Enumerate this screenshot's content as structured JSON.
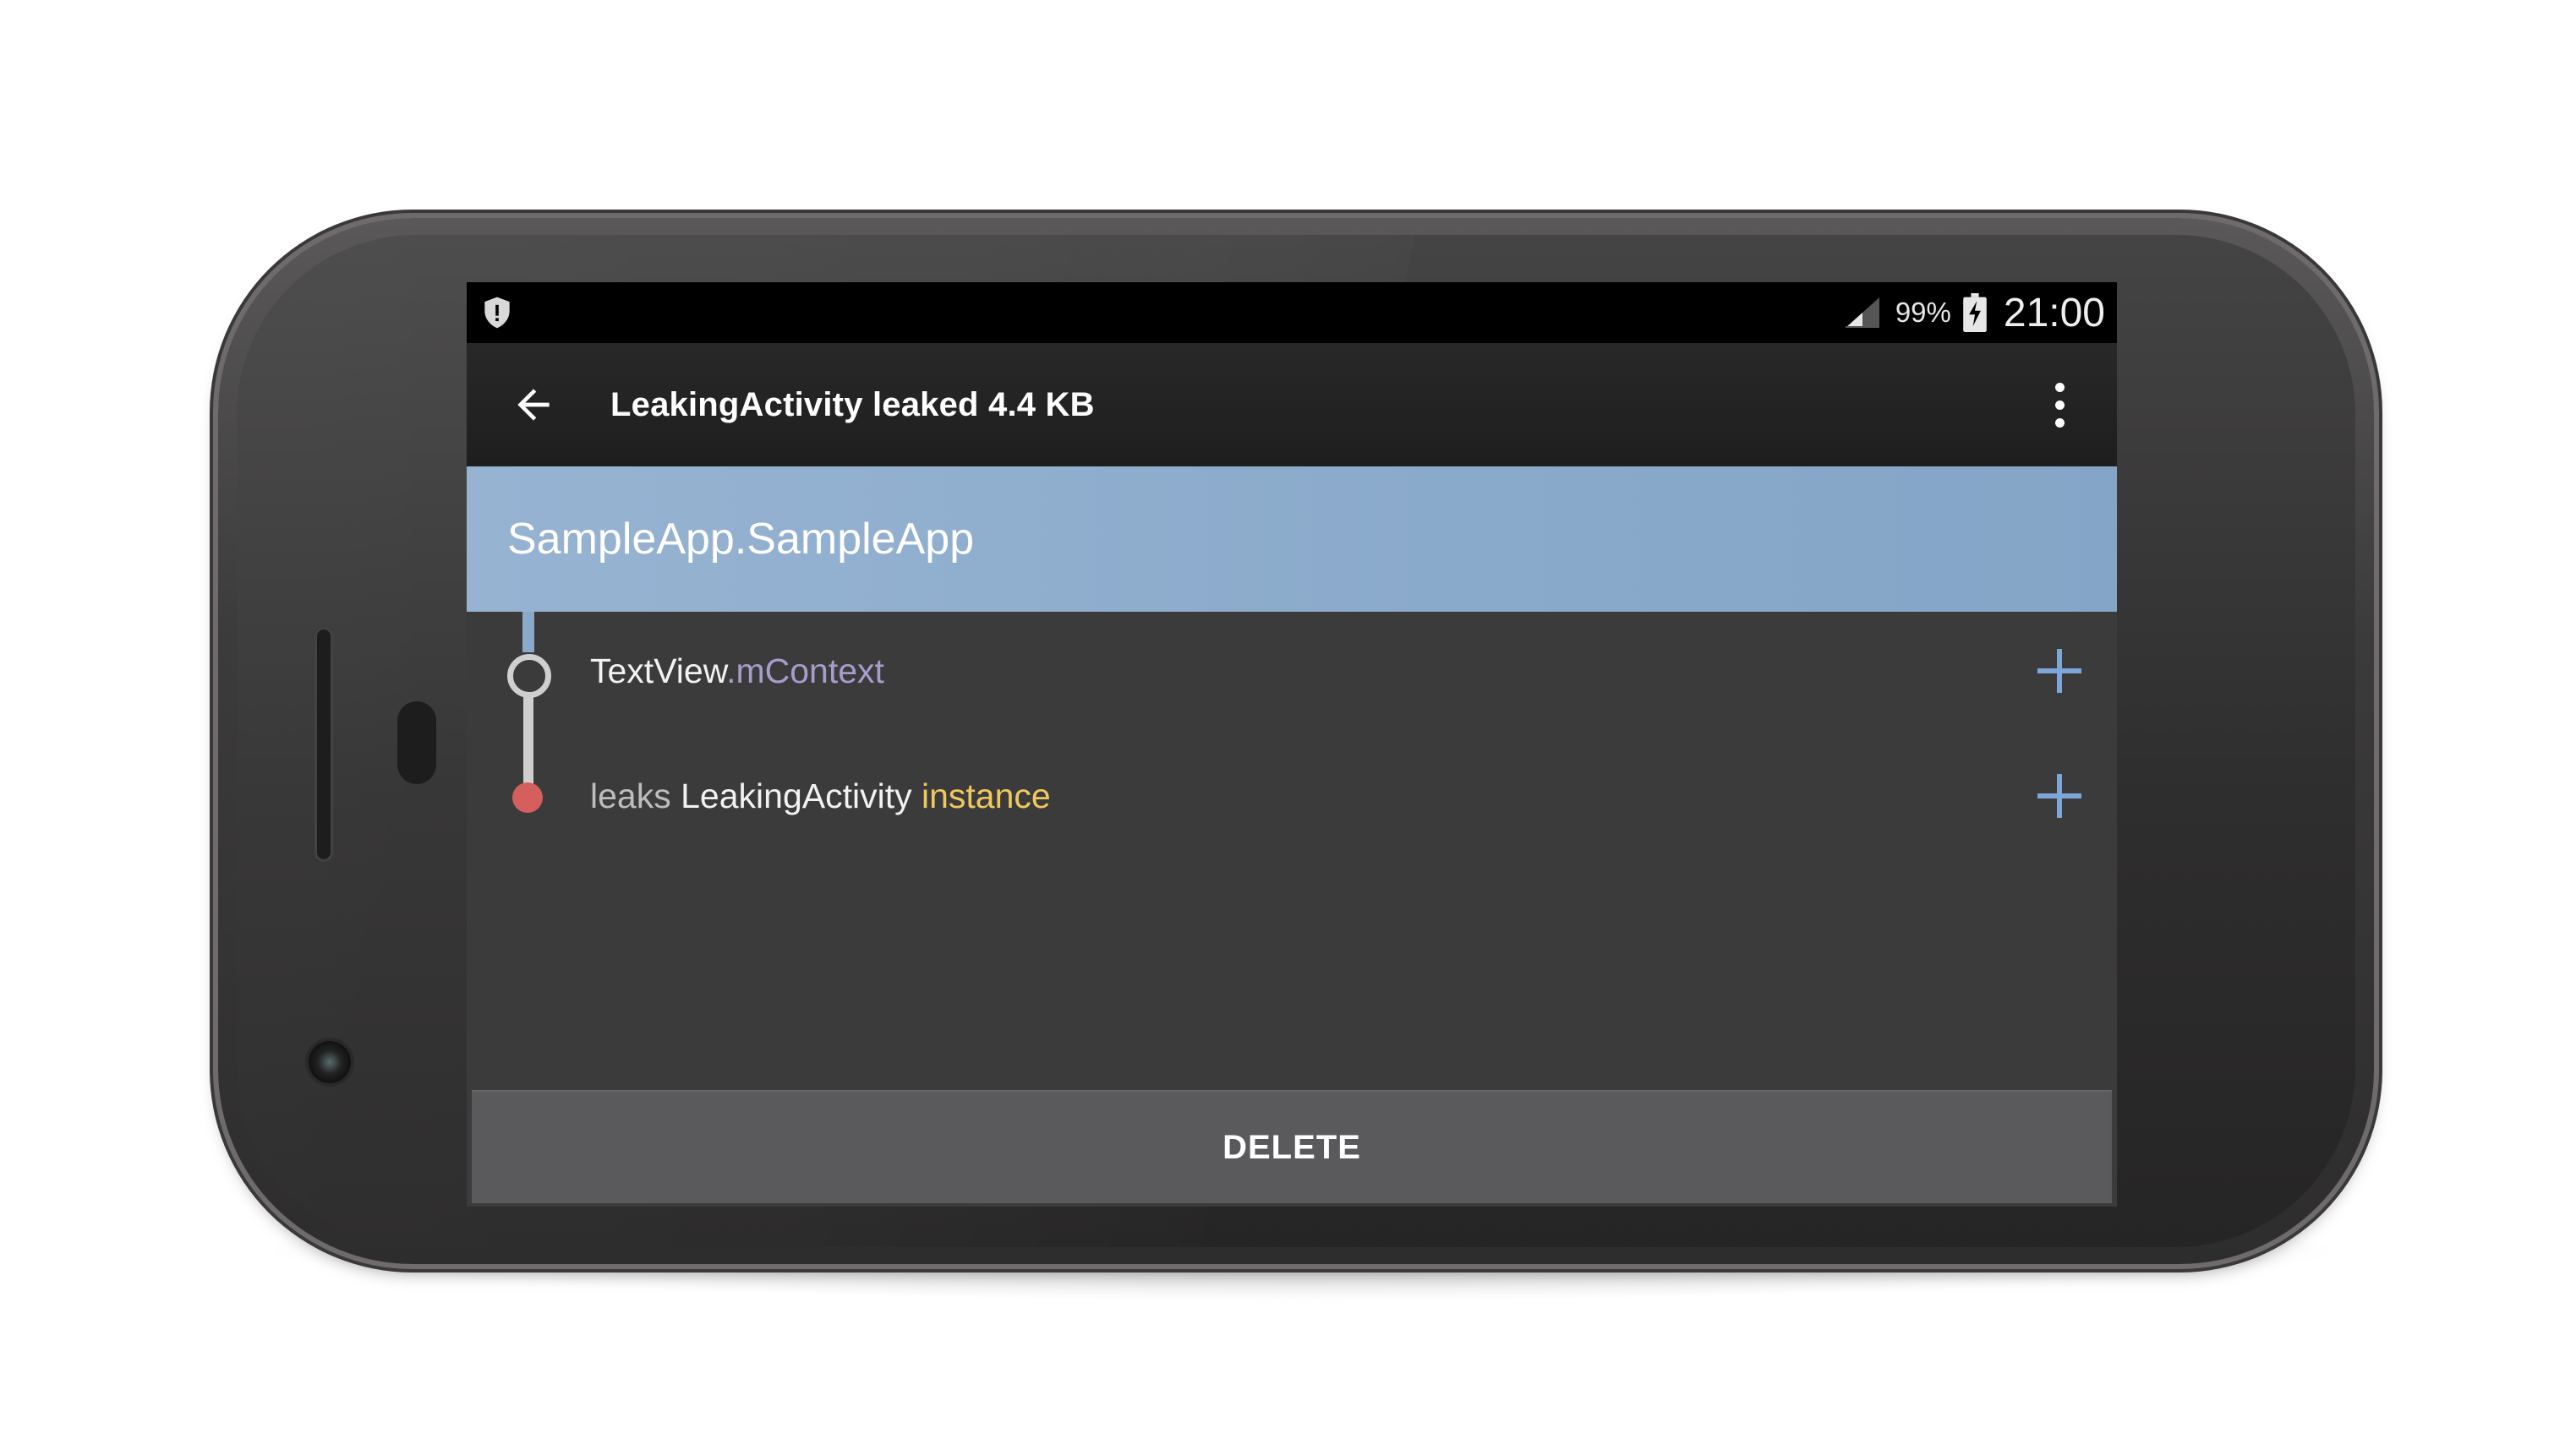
{
  "status_bar": {
    "battery_percent": "99%",
    "time": "21:00",
    "left_icon": "shield-alert-icon",
    "signal_icon": "cell-signal-icon",
    "battery_icon": "battery-charging-icon"
  },
  "app_bar": {
    "title": "LeakingActivity leaked 4.4 KB",
    "back_icon": "arrow-back-icon",
    "menu_icon": "more-vert-icon"
  },
  "leak_trace": {
    "root": "SampleApp.SampleApp",
    "rows": [
      {
        "class_name": "TextView",
        "separator": ".",
        "field": "mContext",
        "expand_icon": "plus-icon"
      },
      {
        "prefix": "leaks",
        "class_name": "LeakingActivity",
        "suffix": "instance",
        "expand_icon": "plus-icon"
      }
    ]
  },
  "actions": {
    "delete_label": "DELETE"
  },
  "colors": {
    "accent_blue": "#8aaacb",
    "field_purple": "#a89ccd",
    "instance_yellow": "#f0c85f",
    "leak_red": "#d45f5c",
    "background": "#3b3b3b"
  }
}
